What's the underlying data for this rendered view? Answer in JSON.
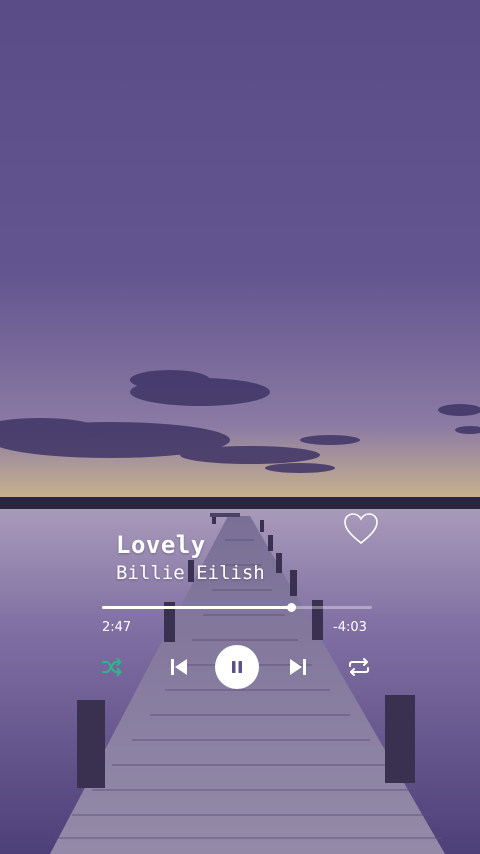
{
  "track": {
    "title": "Lovely",
    "artist": "Billie Eilish",
    "elapsed": "2:47",
    "remaining": "-4:03",
    "progress_fraction": 0.7
  },
  "controls": {
    "shuffle_icon": "shuffle-icon",
    "prev_icon": "skip-previous-icon",
    "play_pause_icon": "pause-icon",
    "next_icon": "skip-next-icon",
    "repeat_icon": "repeat-icon",
    "favorite_icon": "heart-outline-icon"
  },
  "colors": {
    "shuffle_active": "#2fb58d",
    "icons": "#ffffff",
    "accent_sky": "#5d4f8a"
  }
}
